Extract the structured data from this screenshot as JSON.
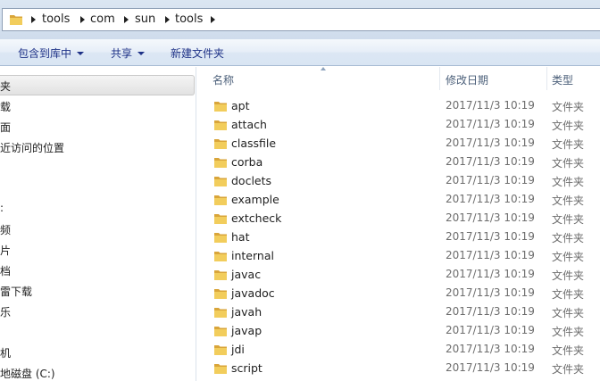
{
  "address": {
    "breadcrumbs": [
      "tools",
      "com",
      "sun",
      "tools"
    ]
  },
  "toolbar": {
    "include_library": "包含到库中",
    "share": "共享",
    "new_folder": "新建文件夹"
  },
  "nav": {
    "items": [
      "夹",
      "载",
      "面",
      "近访问的位置",
      "",
      "",
      "",
      "频",
      "片",
      "档",
      "雷下载",
      "乐",
      "",
      "机",
      "地磁盘 (C:)"
    ]
  },
  "columns": {
    "name": "名称",
    "date": "修改日期",
    "type": "类型"
  },
  "files": [
    {
      "name": "apt",
      "date": "2017/11/3 10:19",
      "type": "文件夹"
    },
    {
      "name": "attach",
      "date": "2017/11/3 10:19",
      "type": "文件夹"
    },
    {
      "name": "classfile",
      "date": "2017/11/3 10:19",
      "type": "文件夹"
    },
    {
      "name": "corba",
      "date": "2017/11/3 10:19",
      "type": "文件夹"
    },
    {
      "name": "doclets",
      "date": "2017/11/3 10:19",
      "type": "文件夹"
    },
    {
      "name": "example",
      "date": "2017/11/3 10:19",
      "type": "文件夹"
    },
    {
      "name": "extcheck",
      "date": "2017/11/3 10:19",
      "type": "文件夹"
    },
    {
      "name": "hat",
      "date": "2017/11/3 10:19",
      "type": "文件夹"
    },
    {
      "name": "internal",
      "date": "2017/11/3 10:19",
      "type": "文件夹"
    },
    {
      "name": "javac",
      "date": "2017/11/3 10:19",
      "type": "文件夹"
    },
    {
      "name": "javadoc",
      "date": "2017/11/3 10:19",
      "type": "文件夹"
    },
    {
      "name": "javah",
      "date": "2017/11/3 10:19",
      "type": "文件夹"
    },
    {
      "name": "javap",
      "date": "2017/11/3 10:19",
      "type": "文件夹"
    },
    {
      "name": "jdi",
      "date": "2017/11/3 10:19",
      "type": "文件夹"
    },
    {
      "name": "script",
      "date": "2017/11/3 10:19",
      "type": "文件夹"
    }
  ],
  "colors": {
    "folder_front": "#f2cd5c",
    "folder_back": "#d9a53a",
    "toolbar_text": "#1e3287"
  },
  "icons": {
    "folder": "folder-icon",
    "breadcrumb_separator": "chevron-right-icon",
    "dropdown": "caret-down-icon"
  }
}
